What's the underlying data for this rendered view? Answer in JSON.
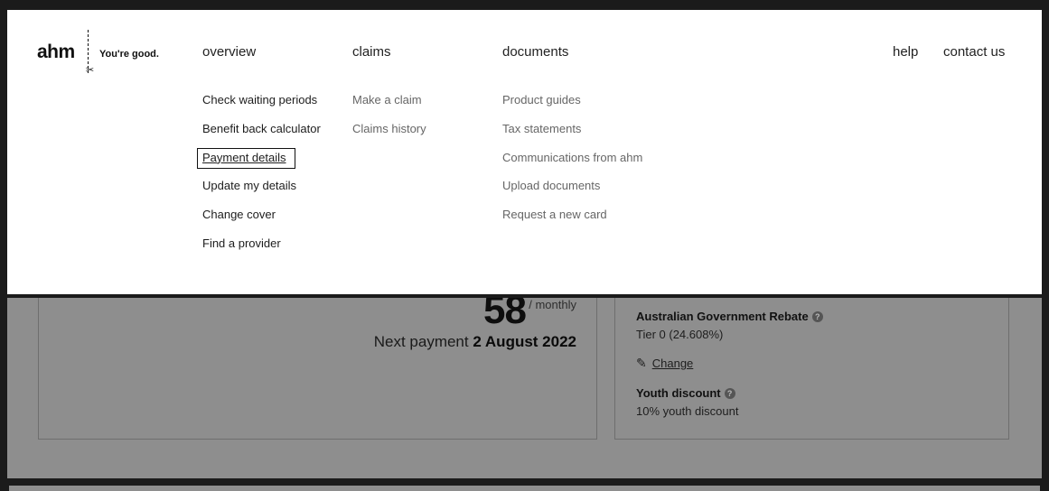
{
  "brand": {
    "name": "ahm",
    "tagline": "You're good."
  },
  "nav": {
    "overview": {
      "label": "overview",
      "items": [
        "Check waiting periods",
        "Benefit back calculator",
        "Payment details",
        "Update my details",
        "Change cover",
        "Find a provider"
      ]
    },
    "claims": {
      "label": "claims",
      "items": [
        "Make a claim",
        "Claims history"
      ]
    },
    "documents": {
      "label": "documents",
      "items": [
        "Product guides",
        "Tax statements",
        "Communications from ahm",
        "Upload documents",
        "Request a new card"
      ]
    },
    "help": "help",
    "contact": "contact us"
  },
  "payment_card": {
    "amount": "58",
    "unit": "/ monthly",
    "next_label": "Next payment",
    "next_date": "2 August 2022"
  },
  "cover_card": {
    "rebate_title": "Australian Government Rebate",
    "rebate_value": "Tier 0 (24.608%)",
    "change_label": "Change",
    "youth_title": "Youth discount",
    "youth_value": "10% youth discount"
  },
  "icons": {
    "help": "question-circle-icon",
    "pencil": "pencil-icon",
    "scissors": "scissors-icon"
  },
  "colors": {
    "overlay_dim": "#8e8e8e",
    "frame": "#1b1b1b",
    "menu_bg": "#ffffff"
  }
}
